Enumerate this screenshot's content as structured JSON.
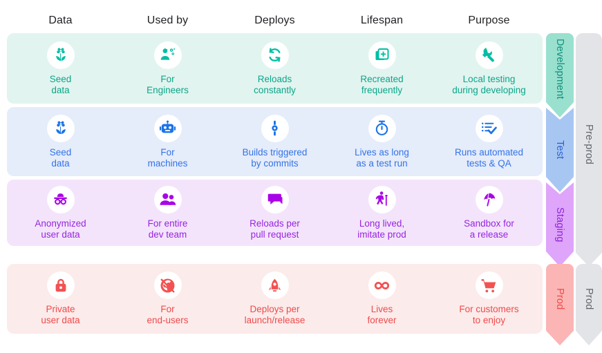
{
  "columns": [
    {
      "label": "Data"
    },
    {
      "label": "Used by"
    },
    {
      "label": "Deploys"
    },
    {
      "label": "Lifespan"
    },
    {
      "label": "Purpose"
    }
  ],
  "colors": {
    "development_accent": "#0aa68a",
    "development_band": "#e2f4ef",
    "development_chevron": "#9ae0cf",
    "test_accent": "#3273e8",
    "test_band": "#e5ecfa",
    "test_chevron": "#a8c6f2",
    "staging_accent": "#9624e0",
    "staging_band": "#f4e4fb",
    "staging_chevron": "#dea5fb",
    "prod_accent": "#ef4a4a",
    "prod_band": "#fcebeb",
    "prod_chevron": "#fbb5b5",
    "group_gray": "#e3e4e8",
    "group_text": "#5f6368",
    "header_text": "#202124"
  },
  "rows": [
    {
      "stage": "Development",
      "cells": [
        {
          "icon": "flower-seedling-icon",
          "label": "Seed\ndata"
        },
        {
          "icon": "engineer-person-gears-icon",
          "label": "For\nEngineers"
        },
        {
          "icon": "refresh-loop-icon",
          "label": "Reloads\nconstantly"
        },
        {
          "icon": "duplicate-add-icon",
          "label": "Recreated\nfrequently"
        },
        {
          "icon": "wrench-screwdriver-icon",
          "label": "Local testing\nduring developing"
        }
      ]
    },
    {
      "stage": "Test",
      "cells": [
        {
          "icon": "flower-seedling-icon",
          "label": "Seed\ndata"
        },
        {
          "icon": "robot-icon",
          "label": "For\nmachines"
        },
        {
          "icon": "commit-node-icon",
          "label": "Builds triggered\nby commits"
        },
        {
          "icon": "stopwatch-icon",
          "label": "Lives as long\nas a test run"
        },
        {
          "icon": "checklist-check-icon",
          "label": "Runs automated\ntests & QA"
        }
      ]
    },
    {
      "stage": "Staging",
      "cells": [
        {
          "icon": "incognito-hat-glasses-icon",
          "label": "Anonymized\nuser data"
        },
        {
          "icon": "people-group-icon",
          "label": "For entire\ndev team"
        },
        {
          "icon": "chat-bubbles-icon",
          "label": "Reloads per\npull request"
        },
        {
          "icon": "elderly-person-cane-icon",
          "label": "Long lived,\nimitate prod"
        },
        {
          "icon": "beach-umbrella-icon",
          "label": "Sandbox for\na release"
        }
      ]
    },
    {
      "stage": "Prod",
      "cells": [
        {
          "icon": "padlock-locked-icon",
          "label": "Private\nuser data"
        },
        {
          "icon": "globe-public-icon",
          "label": "For\nend-users"
        },
        {
          "icon": "rocket-launch-icon",
          "label": "Deploys per\nlaunch/release"
        },
        {
          "icon": "infinity-icon",
          "label": "Lives\nforever"
        },
        {
          "icon": "shopping-cart-icon",
          "label": "For customers\nto enjoy"
        }
      ]
    }
  ],
  "stage_chevrons": [
    {
      "label": "Development"
    },
    {
      "label": "Test"
    },
    {
      "label": "Staging"
    },
    {
      "label": "Prod"
    }
  ],
  "group_chevrons": [
    {
      "label": "Pre-prod"
    },
    {
      "label": "Prod"
    }
  ]
}
